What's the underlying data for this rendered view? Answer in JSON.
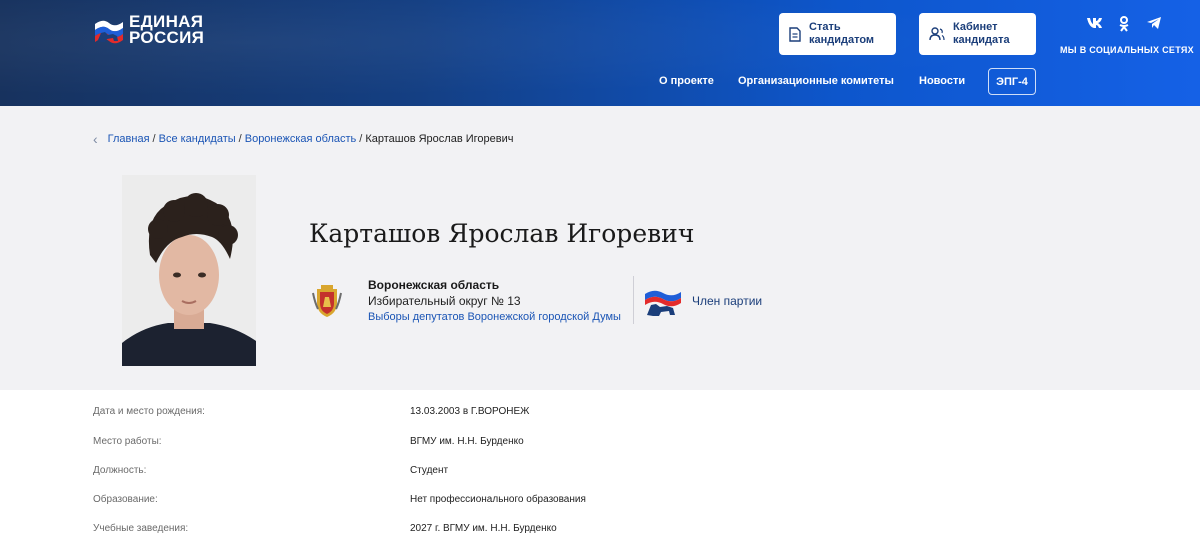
{
  "header": {
    "logo_line1": "ЕДИНАЯ",
    "logo_line2": "РОССИЯ",
    "btn_candidate_line1": "Стать",
    "btn_candidate_line2": "кандидатом",
    "btn_cabinet_line1": "Кабинет",
    "btn_cabinet_line2": "кандидата",
    "social_label": "МЫ В СОЦИАЛЬНЫХ СЕТЯХ",
    "social_icons": [
      "vk-icon",
      "odnoklassniki-icon",
      "telegram-icon"
    ],
    "nav": [
      "О проекте",
      "Организационные комитеты",
      "Новости"
    ],
    "epg": "ЭПГ-4"
  },
  "breadcrumbs": {
    "home": "Главная",
    "all": "Все кандидаты",
    "region": "Воронежская область",
    "current": "Карташов Ярослав Игоревич"
  },
  "candidate": {
    "name": "Карташов Ярослав Игоревич",
    "region": "Воронежская область",
    "district": "Избирательный округ № 13",
    "election": "Выборы депутатов Воронежской городской Думы",
    "status": "Член партии"
  },
  "info": [
    {
      "key": "Дата и место рождения:",
      "value": "13.03.2003 в Г.ВОРОНЕЖ"
    },
    {
      "key": "Место работы:",
      "value": "ВГМУ им. Н.Н. Бурденко"
    },
    {
      "key": "Должность:",
      "value": "Студент"
    },
    {
      "key": "Образование:",
      "value": "Нет профессионального образования"
    },
    {
      "key": "Учебные заведения:",
      "value": "2027 г. ВГМУ им. Н.Н. Бурденко"
    }
  ],
  "colors": {
    "header_dark": "#17325e",
    "header_light": "#1561e6",
    "link": "#1b55b5",
    "profile_bg": "#f2f2f4"
  }
}
